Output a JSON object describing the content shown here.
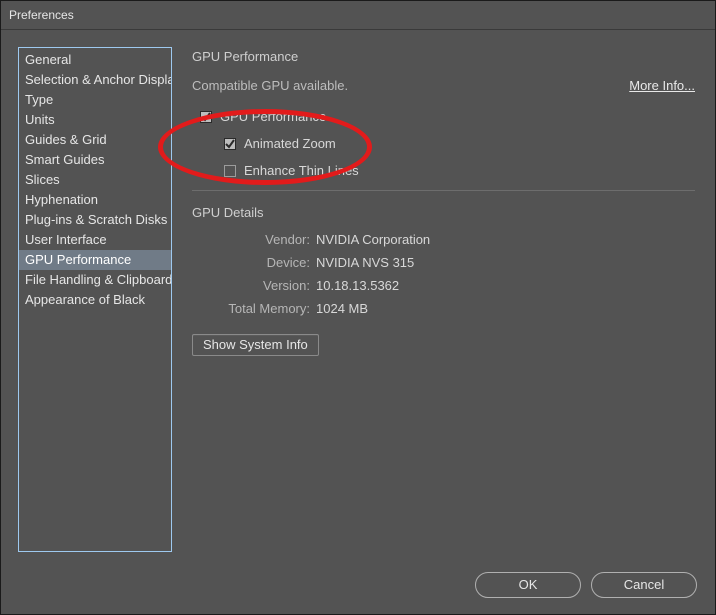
{
  "window": {
    "title": "Preferences"
  },
  "sidebar": {
    "items": [
      {
        "label": "General"
      },
      {
        "label": "Selection & Anchor Display"
      },
      {
        "label": "Type"
      },
      {
        "label": "Units"
      },
      {
        "label": "Guides & Grid"
      },
      {
        "label": "Smart Guides"
      },
      {
        "label": "Slices"
      },
      {
        "label": "Hyphenation"
      },
      {
        "label": "Plug-ins & Scratch Disks"
      },
      {
        "label": "User Interface"
      },
      {
        "label": "GPU Performance",
        "selected": true
      },
      {
        "label": "File Handling & Clipboard"
      },
      {
        "label": "Appearance of Black"
      }
    ]
  },
  "main": {
    "heading": "GPU Performance",
    "status": "Compatible GPU available.",
    "more_info": "More Info...",
    "options": {
      "gpu_performance": {
        "label": "GPU Performance",
        "checked": true
      },
      "animated_zoom": {
        "label": "Animated Zoom",
        "checked": true
      },
      "enhance_thin": {
        "label": "Enhance Thin Lines",
        "checked": false
      }
    },
    "details": {
      "heading": "GPU Details",
      "vendor_k": "Vendor:",
      "vendor_v": "NVIDIA Corporation",
      "device_k": "Device:",
      "device_v": "NVIDIA NVS 315",
      "version_k": "Version:",
      "version_v": "10.18.13.5362",
      "memory_k": "Total Memory:",
      "memory_v": "1024 MB"
    },
    "show_system_info": "Show System Info"
  },
  "footer": {
    "ok": "OK",
    "cancel": "Cancel"
  }
}
